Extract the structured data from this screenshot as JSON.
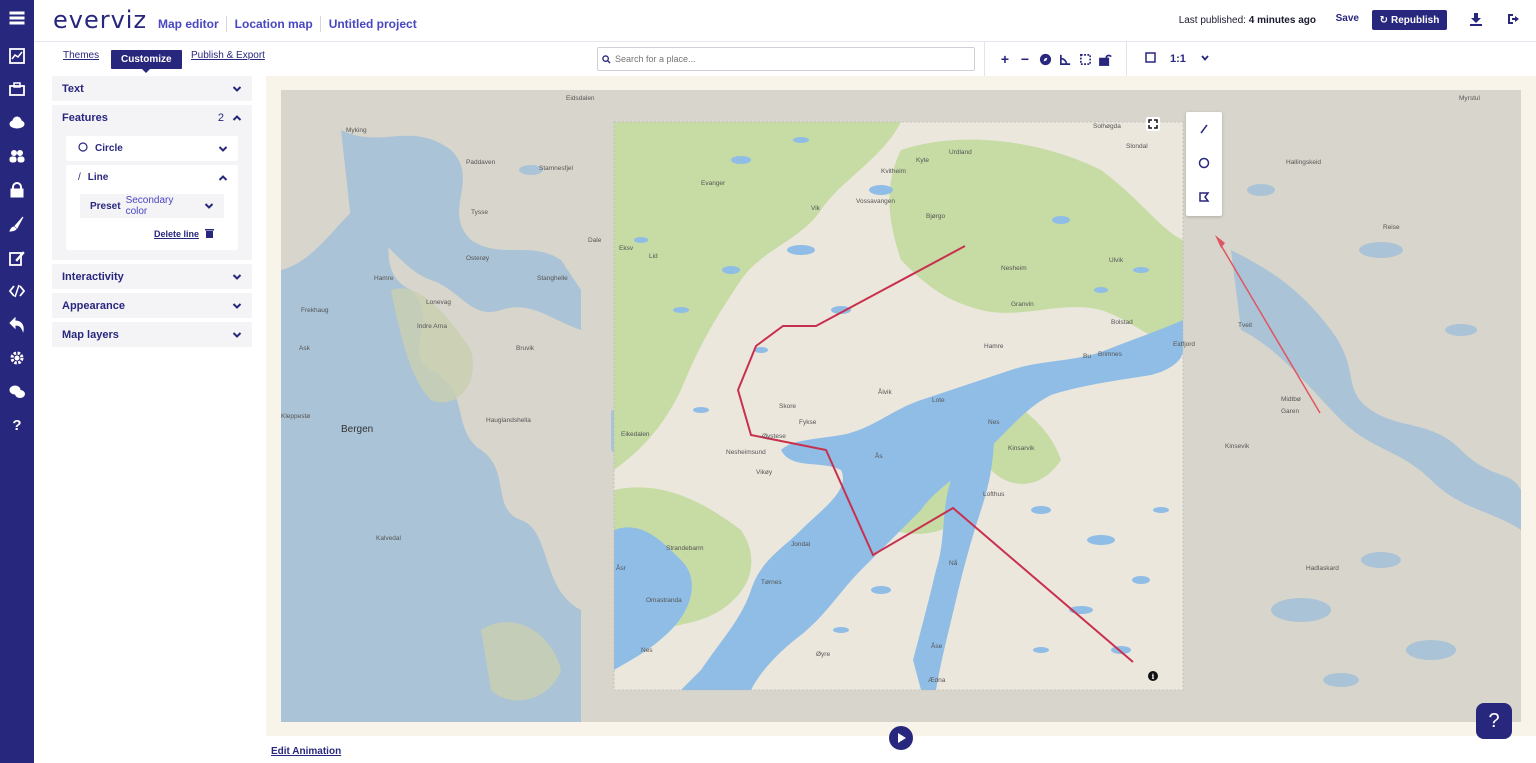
{
  "app": {
    "logo": "everviz"
  },
  "breadcrumbs": [
    "Map editor",
    "Location map",
    "Untitled project"
  ],
  "header": {
    "last_published_label": "Last published:",
    "last_published_value": "4 minutes ago",
    "save_label": "Save",
    "republish_label": "Republish"
  },
  "rail_icons": [
    "menu-icon",
    "chart-icon",
    "packages-icon",
    "cloud-icon",
    "team-icon",
    "lock-icon",
    "brush-icon",
    "edit-icon",
    "code-icon",
    "undo-icon",
    "settings-icon",
    "chat-icon",
    "help-icon"
  ],
  "tabs": {
    "themes": "Themes",
    "customize": "Customize",
    "publish": "Publish & Export"
  },
  "search": {
    "placeholder": "Search for a place..."
  },
  "ratio": {
    "value": "1:1"
  },
  "panel": {
    "text": "Text",
    "features": "Features",
    "features_count": "2",
    "circle": "Circle",
    "line": "Line",
    "preset_label": "Preset",
    "preset_value": "Secondary color",
    "delete_line": "Delete line",
    "interactivity": "Interactivity",
    "appearance": "Appearance",
    "map_layers": "Map layers"
  },
  "map": {
    "labels": [
      "Eidsdalen",
      "Myrstul",
      "Solhøgda",
      "Slondal",
      "Urdland",
      "Kyte",
      "Kvitheim",
      "Evanger",
      "Vik",
      "Vossavangen",
      "Bjørgo",
      "Hallingskeid",
      "Myking",
      "Paddaven",
      "Stamnesfjel",
      "Tysse",
      "Eksv",
      "Sveum",
      "Nesheim",
      "Ulvik",
      "Lid",
      "Dale",
      "Hamre",
      "Osterøy",
      "Stanghelle",
      "Granvin",
      "Reise",
      "Frekhaug",
      "Lonevag",
      "Indre Arna",
      "Hamre",
      "Bolstad",
      "Tveit",
      "Ask",
      "Bruvik",
      "Bu",
      "Brimnes",
      "Eidfjord",
      "Ålvik",
      "Midtbø",
      "Garen",
      "Skore",
      "Fykse",
      "Lote",
      "Kleppestø",
      "Bergen",
      "Hauglandshella",
      "Nes",
      "Øystese",
      "Ås",
      "Kinsarvik",
      "Nesheimsund",
      "Vikøy",
      "Lofthus",
      "Kinsevik",
      "Eikedalen",
      "Strandebarm",
      "Jondal",
      "Hamre",
      "Kalvedal",
      "Hadlaskard",
      "Nå",
      "Tørnes",
      "Omastranda",
      "Nes",
      "Øyre",
      "Åse",
      "Ædna"
    ],
    "city": "Bergen"
  },
  "bottom": {
    "edit_animation": "Edit Animation"
  },
  "help_glyph": "?",
  "colors": {
    "brand": "#28277e",
    "route": "#c8304e",
    "land": "#e6e2d8",
    "water": "#a8c8e8"
  }
}
